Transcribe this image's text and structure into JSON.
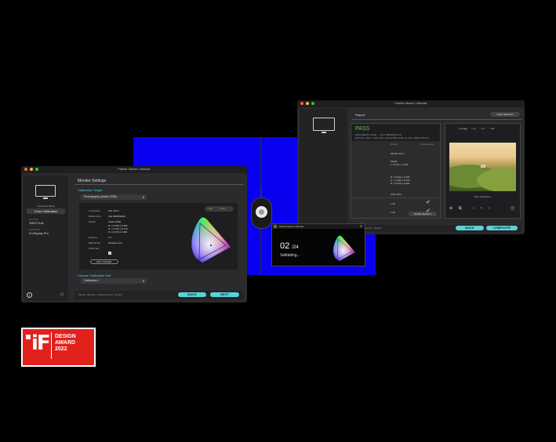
{
  "right_window": {
    "app_title": "Palette Master Ultimate",
    "section_title": "Report",
    "save_report": "SAVE REPORT",
    "result": "PASS",
    "result_line1": "DOCUMENT CODE ... 2X-47JBKWQ07UL8",
    "result_line2": "DEVICE: Cal1 - LCM_DHD_wokeeHDR_DCE_ID_D65_2800X2028.icc",
    "table_headers": [
      "Result",
      "Performance"
    ],
    "values": [
      "200.00 cd/m²",
      "6500K",
      "x: 0.313  y: 0.329",
      "R: x:0.640  y:0.330",
      "G: x:0.300  y:0.600",
      "B: x:0.150  y:0.060",
      "0.00 cd/m²",
      "1.60",
      "1.60"
    ],
    "more_details": "MORE DETAILS",
    "view_options": [
      "Image",
      "xy",
      "u'v'",
      "ab*"
    ],
    "preview_caption": "After Calibration",
    "breadcrumb": "Measurement > Report",
    "back": "BACK",
    "complete": "COMPLETE"
  },
  "left_window": {
    "app_title": "Palette Master Ultimate",
    "sidebar": {
      "label1": "Advanced Mode",
      "selected": "Color Calibration",
      "model_label": "MONITOR",
      "model": "SW271UA",
      "software_label": "SOFTWARE",
      "software": "G-Display Pro"
    },
    "page_title": "Monitor Settings",
    "calibration_target_label": "Calibration Target",
    "calibration_target_value": "Photography (Adobe RGB)",
    "diagram_toggle": [
      "xy",
      "u'v'"
    ],
    "settings": [
      {
        "label": "Luminance",
        "value": "120 cd/m²"
      },
      {
        "label": "White Point",
        "value": "CIE D65(6500K)"
      },
      {
        "label": "Gamut",
        "value": "Adobe RGB"
      },
      {
        "label": "",
        "value": "R: x:0.640   y:0.330"
      },
      {
        "label": "",
        "value": "G: x:0.210   y:0.710"
      },
      {
        "label": "",
        "value": "B: x:0.150   y:0.060"
      },
      {
        "label": "Gamma",
        "value": "2.2"
      },
      {
        "label": "Black Point",
        "value": "absolute zero"
      },
      {
        "label": "Uniformity",
        "value": ""
      }
    ],
    "edit_target": "EDIT TARGET",
    "slot_label": "Choose Calibration Slot",
    "slot_value": "Calibration 1",
    "breadcrumb": "Monitor Settings > Measurement > Report",
    "back": "BACK",
    "next": "NEXT"
  },
  "validate_popup": {
    "title": "Palette Master Ultimate",
    "current": "02",
    "total": "/24",
    "status": "Validating..."
  },
  "award": {
    "logo": "iF",
    "line1": "DESIGN",
    "line2": "AWARD",
    "line3": "2022"
  },
  "colors": {
    "accent": "#5bd2d8",
    "pass_green": "#6cc24a",
    "blue_screen": "#0a00f0",
    "award_red": "#e2201c"
  }
}
